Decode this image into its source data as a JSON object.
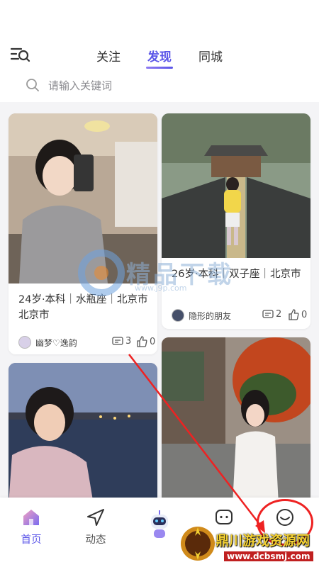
{
  "header": {
    "tabs": [
      {
        "label": "关注",
        "active": false
      },
      {
        "label": "发现",
        "active": true
      },
      {
        "label": "同城",
        "active": false
      }
    ]
  },
  "search": {
    "placeholder": "请输入关键词"
  },
  "cards": [
    {
      "info": "24岁·本科｜水瓶座｜北京市 北京市",
      "author": "幽梦♡逸韵",
      "comments": "3",
      "likes": "0"
    },
    {
      "info": "26岁·本科｜双子座｜北京市",
      "author": "隐形的朋友",
      "comments": "2",
      "likes": "0"
    },
    {
      "info": "",
      "author": "",
      "comments": "",
      "likes": ""
    },
    {
      "info": "",
      "author": "",
      "comments": "",
      "likes": ""
    }
  ],
  "watermark": {
    "text": "精品下载",
    "url": "www.j9p.com"
  },
  "bottom_nav": {
    "items": [
      {
        "label": "首页",
        "icon": "home-icon",
        "active": true
      },
      {
        "label": "动态",
        "icon": "send-icon",
        "active": false
      },
      {
        "label": "",
        "icon": "robot-icon",
        "active": false
      },
      {
        "label": "",
        "icon": "message-icon",
        "active": false
      },
      {
        "label": "",
        "icon": "profile-icon",
        "active": false
      }
    ]
  },
  "brand": {
    "title": "鼎川游戏资源网",
    "url": "www.dcbsmj.com"
  },
  "colors": {
    "accent": "#5b56e8",
    "annotation": "#e22222",
    "background": "#f4f4f6"
  }
}
